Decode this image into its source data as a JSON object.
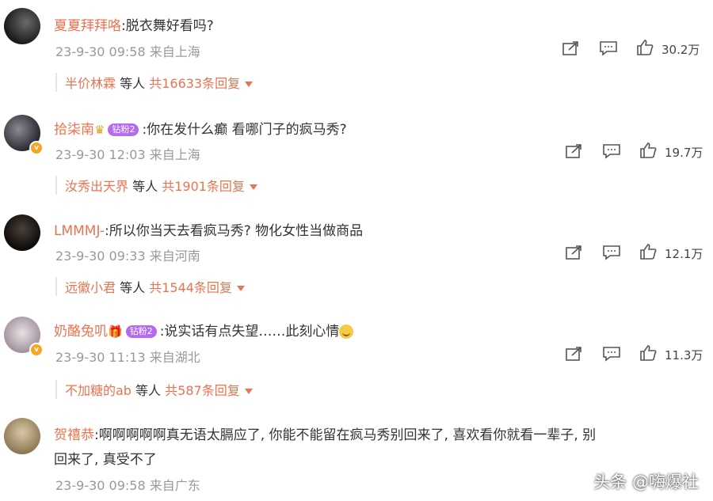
{
  "comments": [
    {
      "username": "夏夏拜拜咯",
      "text": ":脱衣舞好看吗?",
      "meta": "23-9-30 09:58 来自上海",
      "likes": "30.2万",
      "reply": {
        "name": "半价林霖",
        "mid": " 等人 ",
        "count": "共16633条回复"
      },
      "avatar_color": "#2b2b2b"
    },
    {
      "username": "拾柒南",
      "vip": "钻粉2",
      "text": ":你在发什么癫 看哪门子的疯马秀?",
      "meta": "23-9-30 12:03 来自上海",
      "likes": "19.7万",
      "reply": {
        "name": "汝秀出天界",
        "mid": " 等人 ",
        "count": "共1901条回复"
      },
      "avatar_color": "#3a3a44"
    },
    {
      "username": "LMMMJ-",
      "text": ":所以你当天去看疯马秀? 物化女性当做商品",
      "meta": "23-9-30 09:33 来自河南",
      "likes": "12.1万",
      "reply": {
        "name": "远徽小君",
        "mid": " 等人 ",
        "count": "共1544条回复"
      },
      "avatar_color": "#1e1a18"
    },
    {
      "username": "奶酪兔叽",
      "vip": "钻粉2",
      "text": ":说实话有点失望……此刻心情",
      "meta": "23-9-30 11:13 来自湖北",
      "likes": "11.3万",
      "reply": {
        "name": "不加糖的ab",
        "mid": " 等人 ",
        "count": "共587条回复"
      },
      "avatar_color": "#c8bfc4"
    },
    {
      "username": "贺禧恭",
      "text_line1": ":啊啊啊啊啊真无语太膈应了, 你能不能留在疯马秀别回来了, 喜欢看你就看一辈子, 别",
      "text_line2": "回来了, 真受不了",
      "meta": "23-9-30 09:58 来自广东",
      "avatar_color": "#b9a27e"
    }
  ],
  "watermark": "头条 @嗨爆社",
  "colors": {
    "username": "#eb7350",
    "meta": "#999999",
    "text": "#333333"
  }
}
